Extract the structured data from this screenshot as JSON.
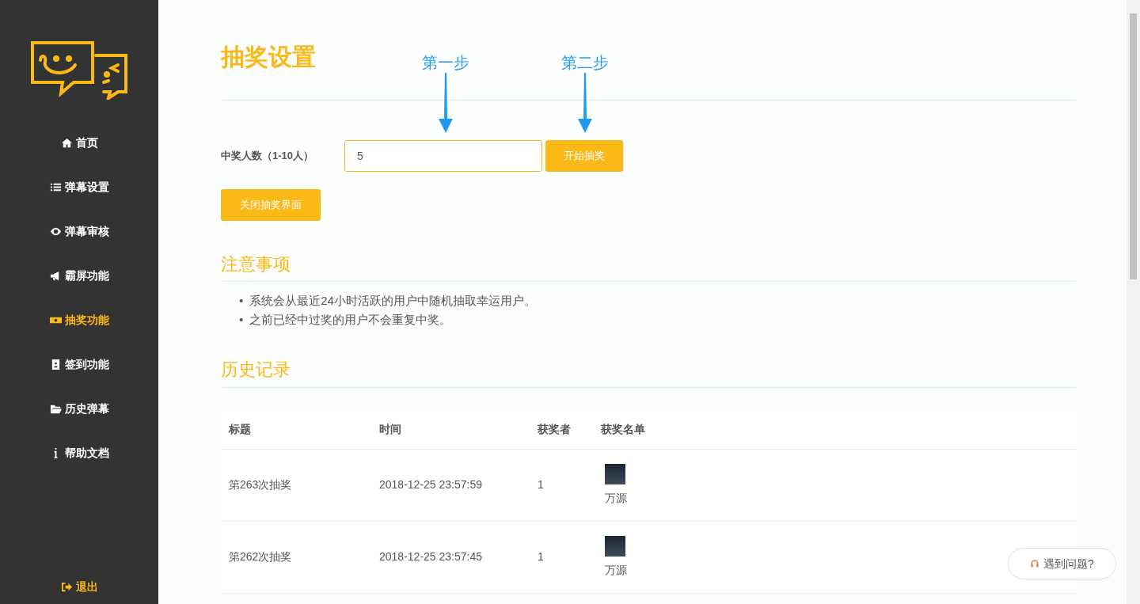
{
  "sidebar": {
    "items": [
      {
        "label": "首页",
        "kind": "home",
        "selected": false
      },
      {
        "label": "弹幕设置",
        "kind": "list",
        "selected": false
      },
      {
        "label": "弹幕审核",
        "kind": "eye",
        "selected": false
      },
      {
        "label": "霸屏功能",
        "kind": "megaphone",
        "selected": false
      },
      {
        "label": "抽奖功能",
        "kind": "money",
        "selected": true
      },
      {
        "label": "签到功能",
        "kind": "badge",
        "selected": false
      },
      {
        "label": "历史弹幕",
        "kind": "folder",
        "selected": false
      },
      {
        "label": "帮助文档",
        "kind": "info",
        "selected": false
      }
    ],
    "logout": "退出"
  },
  "page_title": "抽奖设置",
  "annotations": [
    "第一步",
    "第二步"
  ],
  "form": {
    "label": "中奖人数（1-10人）",
    "value": "5",
    "start_button": "开始抽奖",
    "close_button": "关闭抽奖界面"
  },
  "notes": {
    "heading": "注意事项",
    "bullet": "•",
    "items": [
      "系统会从最近24小时活跃的用户中随机抽取幸运用户。",
      "之前已经中过奖的用户不会重复中奖。"
    ]
  },
  "history": {
    "heading": "历史记录",
    "columns": [
      "标题",
      "时间",
      "获奖者",
      "获奖名单"
    ],
    "rows": [
      {
        "title": "第263次抽奖",
        "time": "2018-12-25 23:57:59",
        "count": "1",
        "winners": [
          "万源"
        ]
      },
      {
        "title": "第262次抽奖",
        "time": "2018-12-25 23:57:45",
        "count": "1",
        "winners": [
          "万源"
        ]
      }
    ]
  },
  "help_button": "遇到问题?"
}
